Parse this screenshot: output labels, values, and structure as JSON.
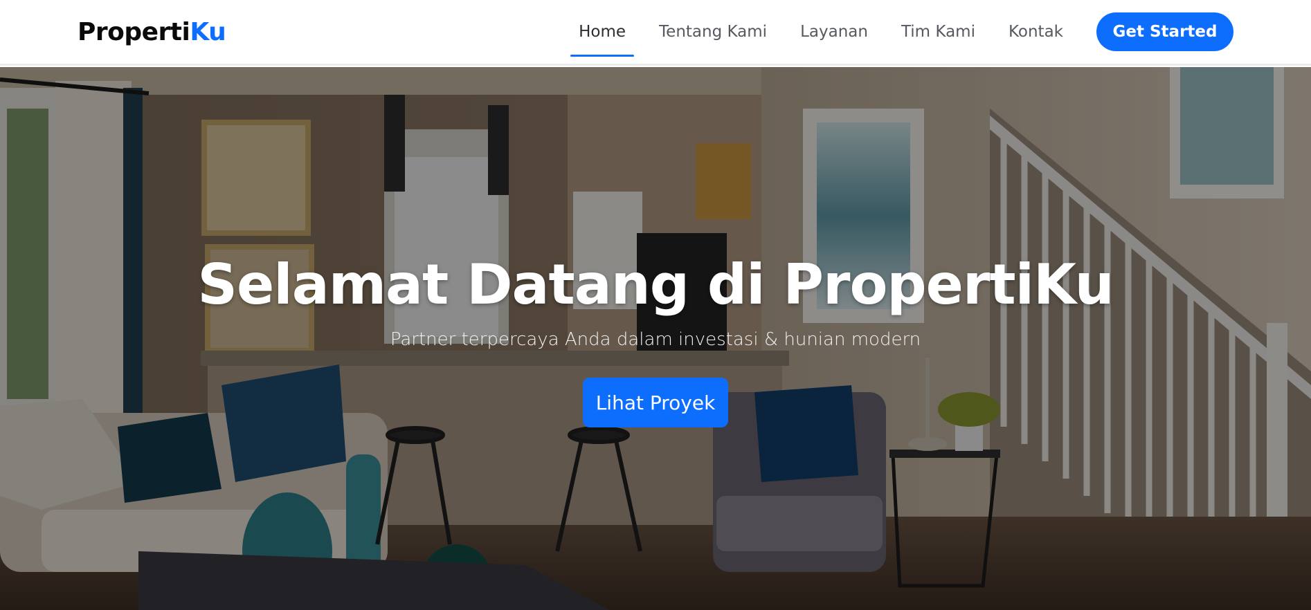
{
  "brand": {
    "name_dark": "Properti",
    "name_accent": "Ku"
  },
  "nav": {
    "items": [
      {
        "label": "Home",
        "active": true
      },
      {
        "label": "Tentang Kami",
        "active": false
      },
      {
        "label": "Layanan",
        "active": false
      },
      {
        "label": "Tim Kami",
        "active": false
      },
      {
        "label": "Kontak",
        "active": false
      }
    ],
    "cta_label": "Get Started"
  },
  "hero": {
    "title": "Selamat Datang di PropertiKu",
    "subtitle": "Partner terpercaya Anda dalam investasi & hunian modern",
    "button_label": "Lihat Proyek"
  },
  "colors": {
    "accent": "#0d6efd",
    "nav_text": "#555a60",
    "overlay": "rgba(0,0,0,0.42)"
  }
}
